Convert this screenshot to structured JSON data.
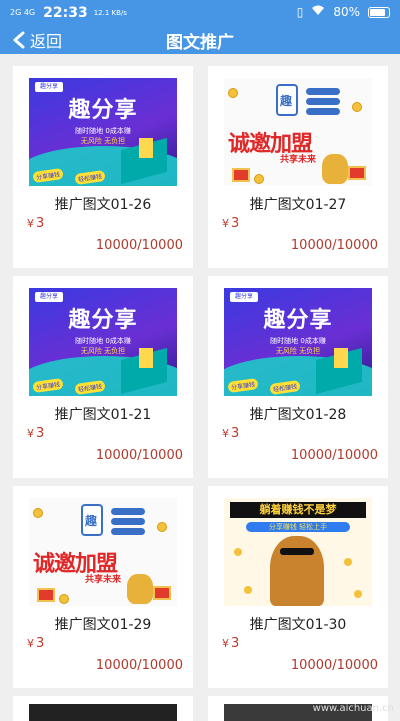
{
  "status": {
    "signal": "2G 4G",
    "time": "22:33",
    "speed": "12.1 KB/s",
    "battery": "80%"
  },
  "nav": {
    "back_label": "返回",
    "title": "图文推广"
  },
  "cards": [
    {
      "title": "推广图文01-26",
      "price": "3",
      "stock": "10000/10000",
      "art": "share"
    },
    {
      "title": "推广图文01-27",
      "price": "3",
      "stock": "10000/10000",
      "art": "invite"
    },
    {
      "title": "推广图文01-21",
      "price": "3",
      "stock": "10000/10000",
      "art": "share"
    },
    {
      "title": "推广图文01-28",
      "price": "3",
      "stock": "10000/10000",
      "art": "share"
    },
    {
      "title": "推广图文01-29",
      "price": "3",
      "stock": "10000/10000",
      "art": "invite"
    },
    {
      "title": "推广图文01-30",
      "price": "3",
      "stock": "10000/10000",
      "art": "mock"
    }
  ],
  "currency_symbol": "¥",
  "art_text": {
    "share": {
      "logo": "趣分享",
      "headline": "趣分享",
      "line1": "随时随地 0成本赚",
      "line2": "无风险 无负担",
      "tag1": "分享赚钱",
      "tag2": "轻松赚钱"
    },
    "invite": {
      "headline": "诚邀加盟",
      "sub": "共享未来"
    },
    "mock": {
      "banner": "躺着赚钱不是梦",
      "ribbon": "分享赚钱 轻松上手"
    }
  },
  "watermark": "www.aichuan.cn"
}
